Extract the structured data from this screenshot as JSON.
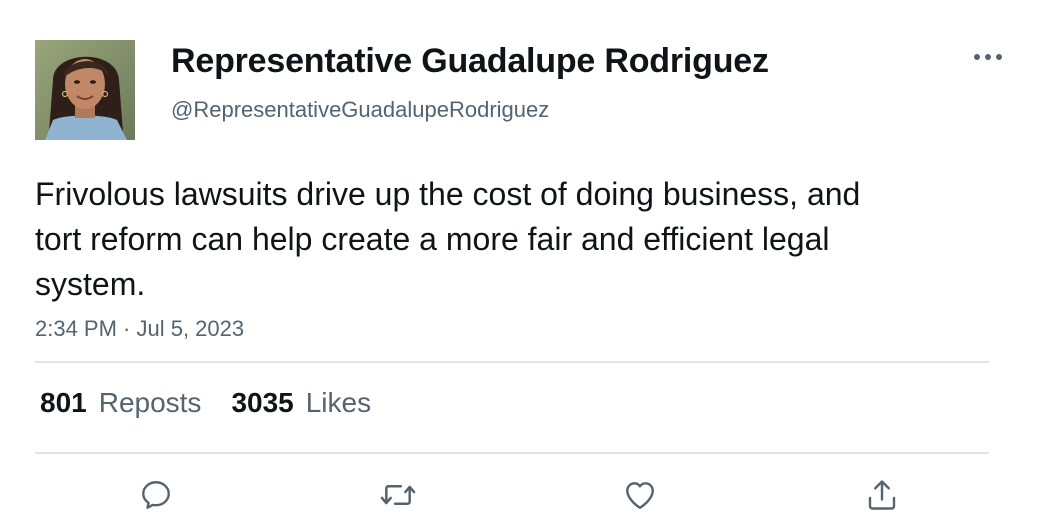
{
  "author": {
    "display_name": "Representative Guadalupe Rodriguez",
    "handle": "@RepresentativeGuadalupeRodriguez"
  },
  "tweet": {
    "text": "Frivolous lawsuits drive up the cost of doing business, and tort reform can help create a more fair and efficient legal system.",
    "timestamp": "2:34 PM · Jul 5, 2023"
  },
  "stats": {
    "reposts_count": "801",
    "reposts_label": "Reposts",
    "likes_count": "3035",
    "likes_label": "Likes"
  },
  "icons": {
    "more": "more-horizontal-icon",
    "reply": "reply-icon",
    "repost": "repost-icon",
    "like": "heart-icon",
    "share": "share-icon"
  },
  "colors": {
    "text_primary": "#0f1419",
    "text_secondary": "#536471",
    "divider": "#e1e4e7",
    "icon": "#536471"
  }
}
